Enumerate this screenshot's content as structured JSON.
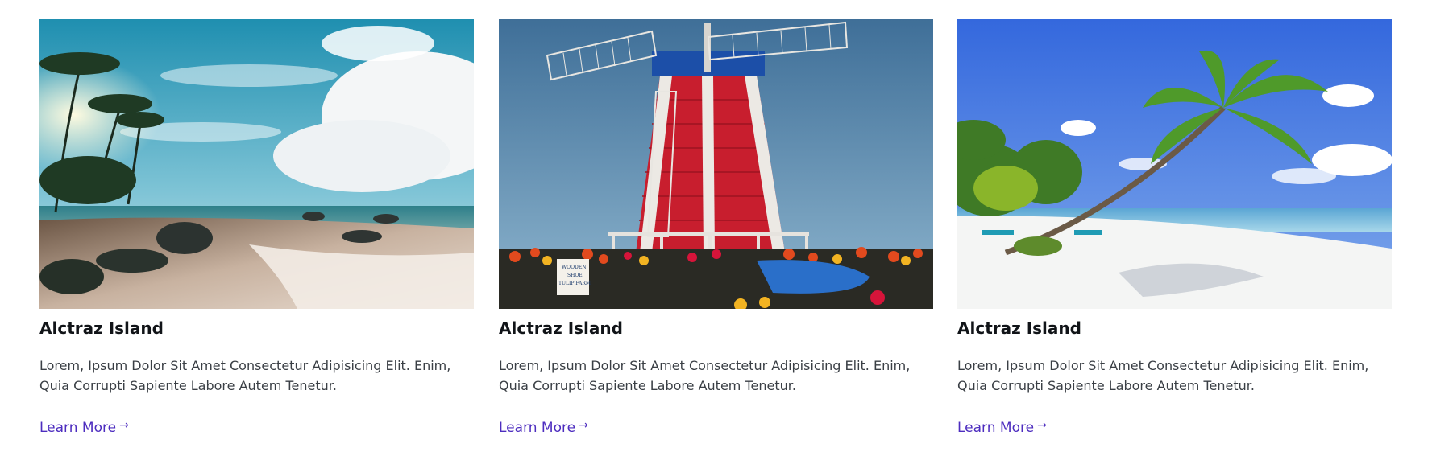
{
  "cards": [
    {
      "image_alt": "beach-rocks-photo",
      "title": "Alctraz Island",
      "description": "Lorem, Ipsum Dolor Sit Amet Consectetur Adipisicing Elit. Enim, Quia Corrupti Sapiente Labore Autem Tenetur.",
      "link_label": "Learn More",
      "link_icon": "arrow-right-icon"
    },
    {
      "image_alt": "windmill-tulip-farm-photo",
      "title": "Alctraz Island",
      "description": "Lorem, Ipsum Dolor Sit Amet Consectetur Adipisicing Elit. Enim, Quia Corrupti Sapiente Labore Autem Tenetur.",
      "link_label": "Learn More",
      "link_icon": "arrow-right-icon",
      "sign_text": [
        "WOODEN",
        "SHOE",
        "TULIP FARM"
      ]
    },
    {
      "image_alt": "palm-tree-beach-photo",
      "title": "Alctraz Island",
      "description": "Lorem, Ipsum Dolor Sit Amet Consectetur Adipisicing Elit. Enim, Quia Corrupti Sapiente Labore Autem Tenetur.",
      "link_label": "Learn More",
      "link_icon": "arrow-right-icon"
    }
  ],
  "colors": {
    "title": "#111418",
    "text": "#3a3f45",
    "link": "#4d2dbf"
  }
}
